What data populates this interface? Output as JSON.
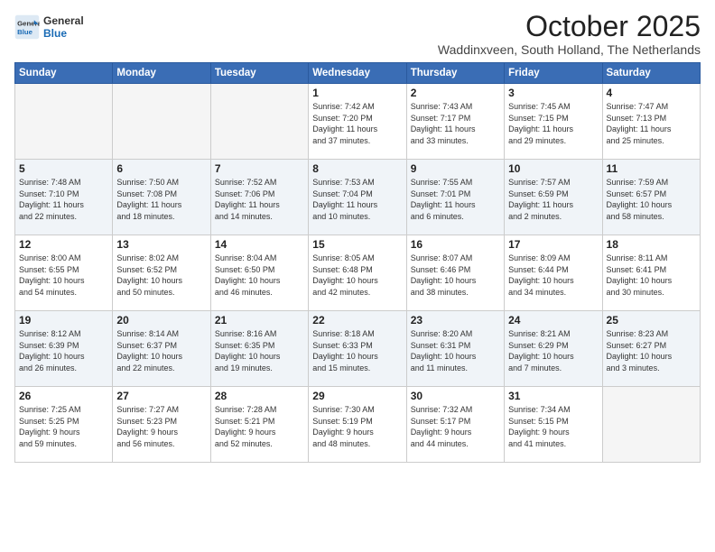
{
  "logo": {
    "general": "General",
    "blue": "Blue"
  },
  "header": {
    "month": "October 2025",
    "location": "Waddinxveen, South Holland, The Netherlands"
  },
  "weekdays": [
    "Sunday",
    "Monday",
    "Tuesday",
    "Wednesday",
    "Thursday",
    "Friday",
    "Saturday"
  ],
  "weeks": [
    [
      {
        "day": "",
        "info": ""
      },
      {
        "day": "",
        "info": ""
      },
      {
        "day": "",
        "info": ""
      },
      {
        "day": "1",
        "info": "Sunrise: 7:42 AM\nSunset: 7:20 PM\nDaylight: 11 hours\nand 37 minutes."
      },
      {
        "day": "2",
        "info": "Sunrise: 7:43 AM\nSunset: 7:17 PM\nDaylight: 11 hours\nand 33 minutes."
      },
      {
        "day": "3",
        "info": "Sunrise: 7:45 AM\nSunset: 7:15 PM\nDaylight: 11 hours\nand 29 minutes."
      },
      {
        "day": "4",
        "info": "Sunrise: 7:47 AM\nSunset: 7:13 PM\nDaylight: 11 hours\nand 25 minutes."
      }
    ],
    [
      {
        "day": "5",
        "info": "Sunrise: 7:48 AM\nSunset: 7:10 PM\nDaylight: 11 hours\nand 22 minutes."
      },
      {
        "day": "6",
        "info": "Sunrise: 7:50 AM\nSunset: 7:08 PM\nDaylight: 11 hours\nand 18 minutes."
      },
      {
        "day": "7",
        "info": "Sunrise: 7:52 AM\nSunset: 7:06 PM\nDaylight: 11 hours\nand 14 minutes."
      },
      {
        "day": "8",
        "info": "Sunrise: 7:53 AM\nSunset: 7:04 PM\nDaylight: 11 hours\nand 10 minutes."
      },
      {
        "day": "9",
        "info": "Sunrise: 7:55 AM\nSunset: 7:01 PM\nDaylight: 11 hours\nand 6 minutes."
      },
      {
        "day": "10",
        "info": "Sunrise: 7:57 AM\nSunset: 6:59 PM\nDaylight: 11 hours\nand 2 minutes."
      },
      {
        "day": "11",
        "info": "Sunrise: 7:59 AM\nSunset: 6:57 PM\nDaylight: 10 hours\nand 58 minutes."
      }
    ],
    [
      {
        "day": "12",
        "info": "Sunrise: 8:00 AM\nSunset: 6:55 PM\nDaylight: 10 hours\nand 54 minutes."
      },
      {
        "day": "13",
        "info": "Sunrise: 8:02 AM\nSunset: 6:52 PM\nDaylight: 10 hours\nand 50 minutes."
      },
      {
        "day": "14",
        "info": "Sunrise: 8:04 AM\nSunset: 6:50 PM\nDaylight: 10 hours\nand 46 minutes."
      },
      {
        "day": "15",
        "info": "Sunrise: 8:05 AM\nSunset: 6:48 PM\nDaylight: 10 hours\nand 42 minutes."
      },
      {
        "day": "16",
        "info": "Sunrise: 8:07 AM\nSunset: 6:46 PM\nDaylight: 10 hours\nand 38 minutes."
      },
      {
        "day": "17",
        "info": "Sunrise: 8:09 AM\nSunset: 6:44 PM\nDaylight: 10 hours\nand 34 minutes."
      },
      {
        "day": "18",
        "info": "Sunrise: 8:11 AM\nSunset: 6:41 PM\nDaylight: 10 hours\nand 30 minutes."
      }
    ],
    [
      {
        "day": "19",
        "info": "Sunrise: 8:12 AM\nSunset: 6:39 PM\nDaylight: 10 hours\nand 26 minutes."
      },
      {
        "day": "20",
        "info": "Sunrise: 8:14 AM\nSunset: 6:37 PM\nDaylight: 10 hours\nand 22 minutes."
      },
      {
        "day": "21",
        "info": "Sunrise: 8:16 AM\nSunset: 6:35 PM\nDaylight: 10 hours\nand 19 minutes."
      },
      {
        "day": "22",
        "info": "Sunrise: 8:18 AM\nSunset: 6:33 PM\nDaylight: 10 hours\nand 15 minutes."
      },
      {
        "day": "23",
        "info": "Sunrise: 8:20 AM\nSunset: 6:31 PM\nDaylight: 10 hours\nand 11 minutes."
      },
      {
        "day": "24",
        "info": "Sunrise: 8:21 AM\nSunset: 6:29 PM\nDaylight: 10 hours\nand 7 minutes."
      },
      {
        "day": "25",
        "info": "Sunrise: 8:23 AM\nSunset: 6:27 PM\nDaylight: 10 hours\nand 3 minutes."
      }
    ],
    [
      {
        "day": "26",
        "info": "Sunrise: 7:25 AM\nSunset: 5:25 PM\nDaylight: 9 hours\nand 59 minutes."
      },
      {
        "day": "27",
        "info": "Sunrise: 7:27 AM\nSunset: 5:23 PM\nDaylight: 9 hours\nand 56 minutes."
      },
      {
        "day": "28",
        "info": "Sunrise: 7:28 AM\nSunset: 5:21 PM\nDaylight: 9 hours\nand 52 minutes."
      },
      {
        "day": "29",
        "info": "Sunrise: 7:30 AM\nSunset: 5:19 PM\nDaylight: 9 hours\nand 48 minutes."
      },
      {
        "day": "30",
        "info": "Sunrise: 7:32 AM\nSunset: 5:17 PM\nDaylight: 9 hours\nand 44 minutes."
      },
      {
        "day": "31",
        "info": "Sunrise: 7:34 AM\nSunset: 5:15 PM\nDaylight: 9 hours\nand 41 minutes."
      },
      {
        "day": "",
        "info": ""
      }
    ]
  ]
}
